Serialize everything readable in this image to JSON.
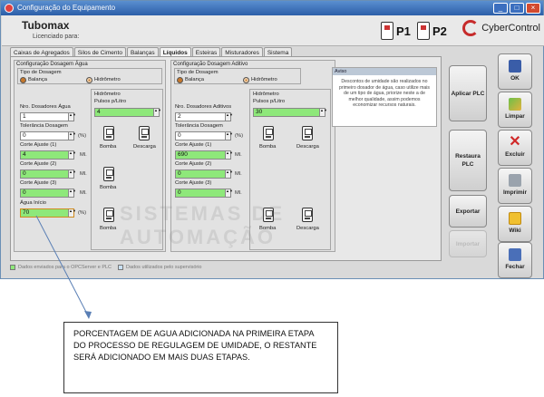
{
  "window": {
    "title": "Configuração do Equipamento"
  },
  "header": {
    "app_name": "Tubomax",
    "license_label": "Licenciado para:",
    "p1": "P1",
    "p2": "P2",
    "brand": "CyberControl"
  },
  "tabs": [
    "Caixas de Agregados",
    "Silos de Cimento",
    "Balanças",
    "Líquidos",
    "Esteiras",
    "Misturadores",
    "Sistema"
  ],
  "agua": {
    "title": "Configuração Dosagem Água",
    "tipo_label": "Tipo de Dosagem",
    "opt_balanca": "Balança",
    "opt_hidrometro": "Hidrômetro",
    "nro_label": "Nro. Dosadores Água",
    "nro_value": "1",
    "tol_label": "Tolerância Dosagem",
    "tol_value": "0",
    "tol_unit": "(%)",
    "c1_label": "Corte Ajuste (1)",
    "c1_value": "4",
    "c2_label": "Corte Ajuste (2)",
    "c2_value": "0",
    "c3_label": "Corte Ajuste (3)",
    "c3_value": "0",
    "inicio_label": "Água Início",
    "inicio_value": "70",
    "ml": "Ml.",
    "pct": "(%)",
    "hid_title": "Hidrômetro",
    "pulsos_label": "Pulsos p/Litro",
    "pulsos_value": "4",
    "bomba": "Bomba",
    "descarga": "Descarga"
  },
  "aditivo": {
    "title": "Configuração Dosagem Aditivo",
    "tipo_label": "Tipo de Dosagem",
    "opt_balanca": "Balança",
    "opt_hidrometro": "Hidrômetro",
    "nro_label": "Nro. Dosadores Aditivos",
    "nro_value": "2",
    "tol_label": "Tolerância Dosagem",
    "tol_value": "0",
    "tol_unit": "(%)",
    "c1_label": "Corte Ajuste (1)",
    "c1_value": "690",
    "c2_label": "Corte Ajuste (2)",
    "c2_value": "0",
    "c3_label": "Corte Ajuste (3)",
    "c3_value": "0",
    "ml": "Ml.",
    "hid_title": "Hidrômetro",
    "pulsos_label": "Pulsos p/Litro",
    "pulsos_value": "30",
    "bomba": "Bomba",
    "descarga": "Descarga"
  },
  "aviso": {
    "title": "Aviso",
    "text": "Descontos de umidade são realizados no primeiro dosador de água, caso utilize mais de um tipo de água, priorize neste a de melhor qualidade, assim podemos economizar recursos naturais."
  },
  "actions": {
    "aplicar": "Aplicar PLC",
    "restaura": "Restaura PLC",
    "exportar": "Exportar",
    "importar": "Importar"
  },
  "side": {
    "ok": "OK",
    "limpar": "Limpar",
    "excluir": "Excluir",
    "imprimir": "Imprimir",
    "wiki": "Wiki",
    "fechar": "Fechar"
  },
  "legend": {
    "opc": "Dados enviados para o OPCServer e PLC",
    "sup": "Dados utilizados pelo supervisório"
  },
  "watermark": "SISTEMAS DE AUTOMAÇÃO",
  "annotation": "PORCENTAGEM DE AGUA ADICIONADA NA PRIMEIRA ETAPA DO PROCESSO DE REGULAGEM DE UMIDADE, O RESTANTE SERÁ ADICIONADO EM MAIS DUAS ETAPAS.",
  "colors": {
    "accent_green": "#8ee87a",
    "title_blue": "#2c5ea8",
    "brand_red": "#c62a2a"
  }
}
